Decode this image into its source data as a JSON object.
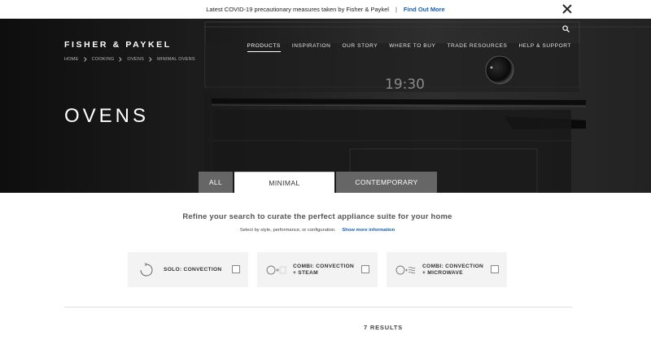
{
  "alert": {
    "message": "Latest COVID-19 precautionary measures taken by Fisher & Paykel",
    "separator": "|",
    "link": "Find Out More"
  },
  "header": {
    "logo": "FISHER & PAYKEL",
    "nav": [
      "PRODUCTS",
      "INSPIRATION",
      "OUR STORY",
      "WHERE TO BUY",
      "TRADE RESOURCES",
      "HELP & SUPPORT"
    ],
    "active_nav": "PRODUCTS"
  },
  "breadcrumb": [
    "HOME",
    "COOKING",
    "OVENS",
    "MINIMAL OVENS"
  ],
  "hero": {
    "title": "OVENS",
    "clock": "19:30"
  },
  "tabs": [
    "ALL",
    "MINIMAL",
    "CONTEMPORARY"
  ],
  "active_tab": "MINIMAL",
  "refine": {
    "title": "Refine your search to curate the perfect appliance suite for your home",
    "subtitle": "Select by style, performance, or configuration.",
    "more_link": "Show more information"
  },
  "filters": [
    {
      "label": "SOLO: CONVECTION",
      "icon": "convection-icon"
    },
    {
      "label": "COMBI: CONVECTION + STEAM",
      "icon": "convection-steam-icon"
    },
    {
      "label": "COMBI: CONVECTION + MICROWAVE",
      "icon": "convection-microwave-icon"
    }
  ],
  "results": "7 RESULTS"
}
